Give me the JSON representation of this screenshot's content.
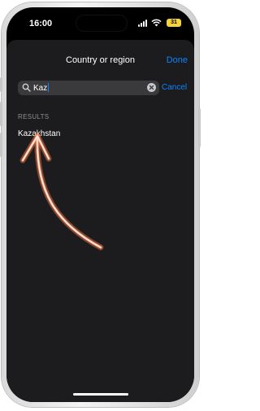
{
  "status_bar": {
    "time": "16:00",
    "battery": "31"
  },
  "nav": {
    "title": "Country or region",
    "done_label": "Done"
  },
  "search": {
    "value": "Kaz",
    "cancel_label": "Cancel"
  },
  "results": {
    "header": "RESULTS",
    "items": [
      {
        "label": "Kazakhstan"
      }
    ]
  },
  "icons": {
    "search": "search-icon",
    "clear": "clear-icon",
    "signal": "signal-icon",
    "wifi": "wifi-icon",
    "battery": "battery-icon",
    "annotation": "arrow-annotation"
  },
  "colors": {
    "accent": "#0a84ff",
    "battery": "#f5d43a",
    "annotation_arrow": "#ff8a5c"
  }
}
